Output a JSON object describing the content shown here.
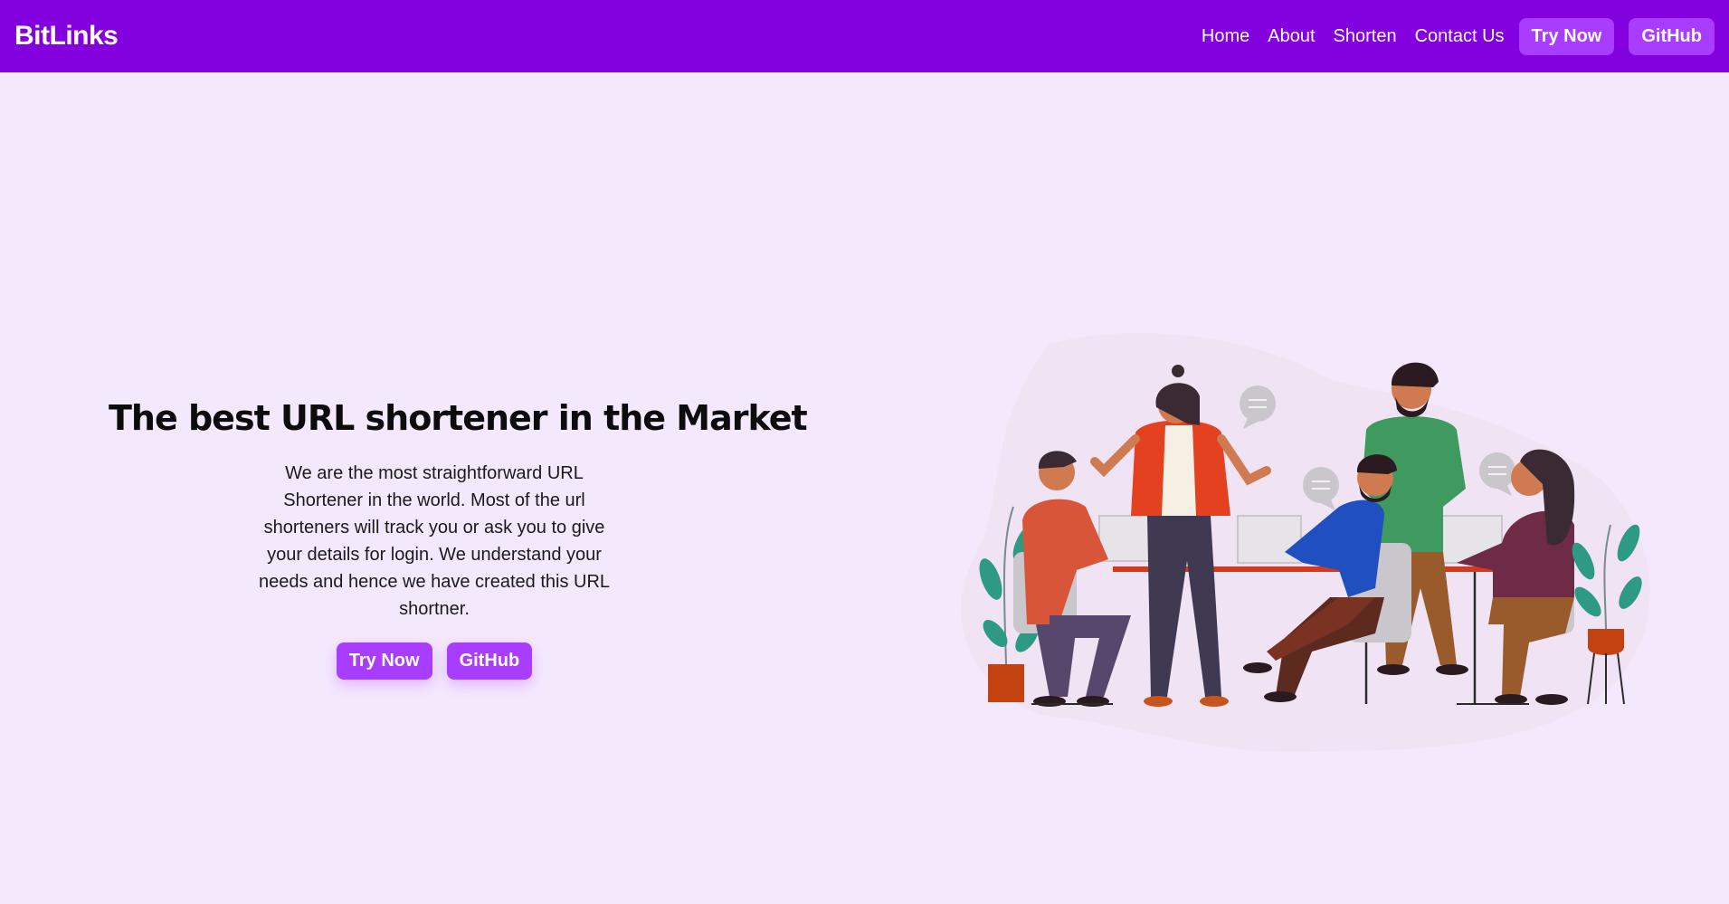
{
  "navbar": {
    "brand": "BitLinks",
    "links": [
      "Home",
      "About",
      "Shorten",
      "Contact Us"
    ],
    "try_now": "Try Now",
    "github": "GitHub"
  },
  "hero": {
    "title": "The best URL shortener in the Market",
    "description": "We are the most straightforward URL Shortener in the world. Most of the url shorteners will track you or ask you to give your details for login. We understand your needs and hence we have created this URL shortner.",
    "try_now": "Try Now",
    "github": "GitHub"
  },
  "colors": {
    "navbar_bg": "#8300df",
    "page_bg": "#f4e8fd",
    "button_bg": "#a83cff"
  }
}
